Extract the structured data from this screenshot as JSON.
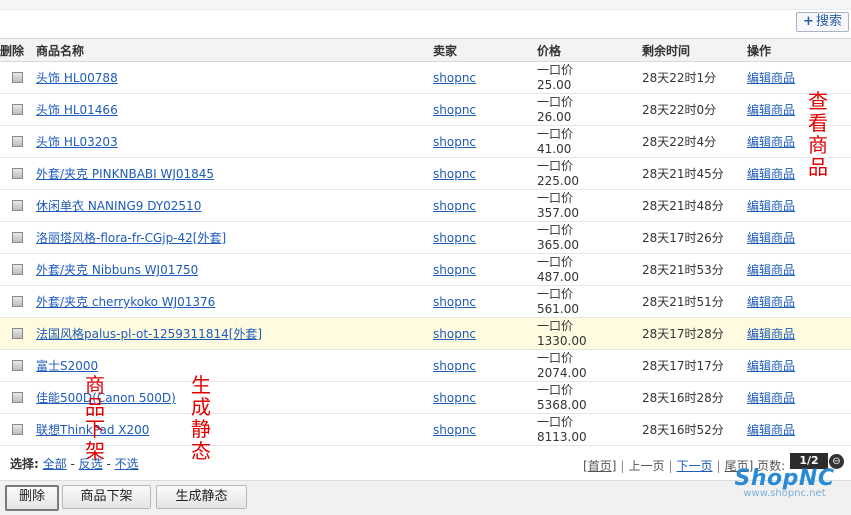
{
  "toolbar": {
    "search_label": "搜索"
  },
  "table": {
    "headers": {
      "del": "删除",
      "name": "商品名称",
      "seller": "卖家",
      "price": "价格",
      "time": "剩余时间",
      "action": "操作"
    },
    "rows": [
      {
        "name": "头饰  HL00788",
        "seller": "shopnc",
        "price_label": "一口价",
        "price": "25.00",
        "time": "28天22时1分",
        "action": "编辑商品",
        "highlight": false
      },
      {
        "name": "头饰  HL01466",
        "seller": "shopnc",
        "price_label": "一口价",
        "price": "26.00",
        "time": "28天22时0分",
        "action": "编辑商品",
        "highlight": false
      },
      {
        "name": "头饰  HL03203",
        "seller": "shopnc",
        "price_label": "一口价",
        "price": "41.00",
        "time": "28天22时4分",
        "action": "编辑商品",
        "highlight": false
      },
      {
        "name": "外套/夹克  PINKNBABI WJ01845",
        "seller": "shopnc",
        "price_label": "一口价",
        "price": "225.00",
        "time": "28天21时45分",
        "action": "编辑商品",
        "highlight": false
      },
      {
        "name": "休闲单衣  NANING9 DY02510",
        "seller": "shopnc",
        "price_label": "一口价",
        "price": "357.00",
        "time": "28天21时48分",
        "action": "编辑商品",
        "highlight": false
      },
      {
        "name": "洛丽塔风格-flora-fr-CGjp-42[外套]",
        "seller": "shopnc",
        "price_label": "一口价",
        "price": "365.00",
        "time": "28天17时26分",
        "action": "编辑商品",
        "highlight": false
      },
      {
        "name": "外套/夹克  Nibbuns WJ01750",
        "seller": "shopnc",
        "price_label": "一口价",
        "price": "487.00",
        "time": "28天21时53分",
        "action": "编辑商品",
        "highlight": false
      },
      {
        "name": "外套/夹克  cherrykoko WJ01376",
        "seller": "shopnc",
        "price_label": "一口价",
        "price": "561.00",
        "time": "28天21时51分",
        "action": "编辑商品",
        "highlight": false
      },
      {
        "name": "法国风格palus-pl-ot-1259311814[外套]",
        "seller": "shopnc",
        "price_label": "一口价",
        "price": "1330.00",
        "time": "28天17时28分",
        "action": "编辑商品",
        "highlight": true
      },
      {
        "name": "富士S2000",
        "seller": "shopnc",
        "price_label": "一口价",
        "price": "2074.00",
        "time": "28天17时17分",
        "action": "编辑商品",
        "highlight": false
      },
      {
        "name": "佳能500D(Canon 500D)",
        "seller": "shopnc",
        "price_label": "一口价",
        "price": "5368.00",
        "time": "28天16时28分",
        "action": "编辑商品",
        "highlight": false
      },
      {
        "name": "联想ThinkPad X200",
        "seller": "shopnc",
        "price_label": "一口价",
        "price": "8113.00",
        "time": "28天16时52分",
        "action": "编辑商品",
        "highlight": false
      }
    ]
  },
  "selection": {
    "label": "选择:",
    "all": "全部",
    "invert": "反选",
    "none": "不选"
  },
  "pager": {
    "first": "首页",
    "prev": "上一页",
    "next": "下一页",
    "last": "尾页",
    "pages_label": "页数:",
    "page_info": "1/2"
  },
  "buttons": {
    "delete": "删除",
    "unlist": "商品下架",
    "generate": "生成静态"
  },
  "annotations": {
    "view": [
      "查",
      "看",
      "商",
      "品"
    ],
    "unlist": [
      "商",
      "品",
      "下",
      "架"
    ],
    "generate": [
      "生",
      "成",
      "静",
      "态"
    ]
  },
  "logo": {
    "brand": "ShopNC",
    "url": "www.shopnc.net"
  },
  "colors": {
    "link": "#1e5bb8",
    "annotation": "#e00000",
    "highlight_row": "#fffbe0",
    "logo": "#2a8ad4"
  }
}
